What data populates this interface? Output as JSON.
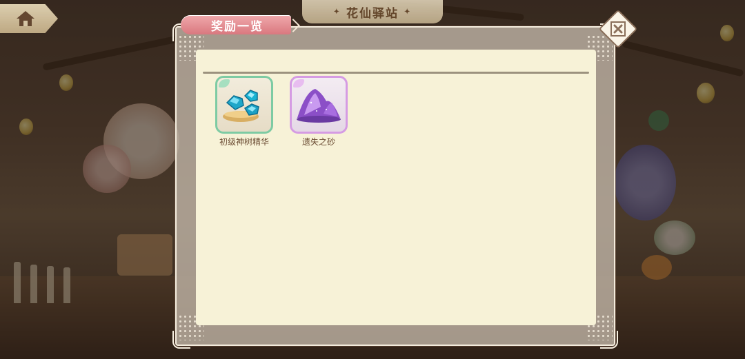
{
  "top_bar": {
    "home_icon": "home-icon",
    "station_title": "花仙驿站"
  },
  "dialog": {
    "title": "奖励一览",
    "close_icon": "close-icon",
    "items": [
      {
        "name": "初级神树精华",
        "icon": "essence-gems-icon",
        "rarity_color": "#7dcba3"
      },
      {
        "name": "遗失之砂",
        "icon": "purple-sand-icon",
        "rarity_color": "#d59be3"
      }
    ]
  },
  "colors": {
    "title_ribbon": "#d9787f",
    "panel_bg": "#f7f2d7",
    "text_brown": "#6a4b32"
  }
}
